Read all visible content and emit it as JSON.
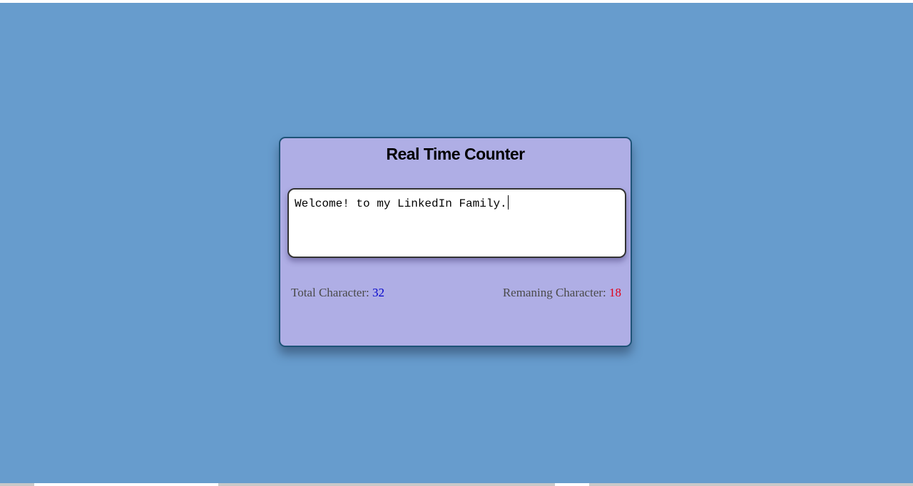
{
  "app": {
    "title": "Real Time Counter"
  },
  "editor": {
    "value": "Welcome! to my LinkedIn Family."
  },
  "stats": {
    "total_label": "Total Character: ",
    "total_value": "32",
    "remaining_label": "Remaning Character: ",
    "remaining_value": "18"
  },
  "colors": {
    "background": "#679ccd",
    "card": "#afaee5",
    "card_border": "#1e5378",
    "total_value": "#0000cc",
    "remaining_value": "#e0001b"
  }
}
